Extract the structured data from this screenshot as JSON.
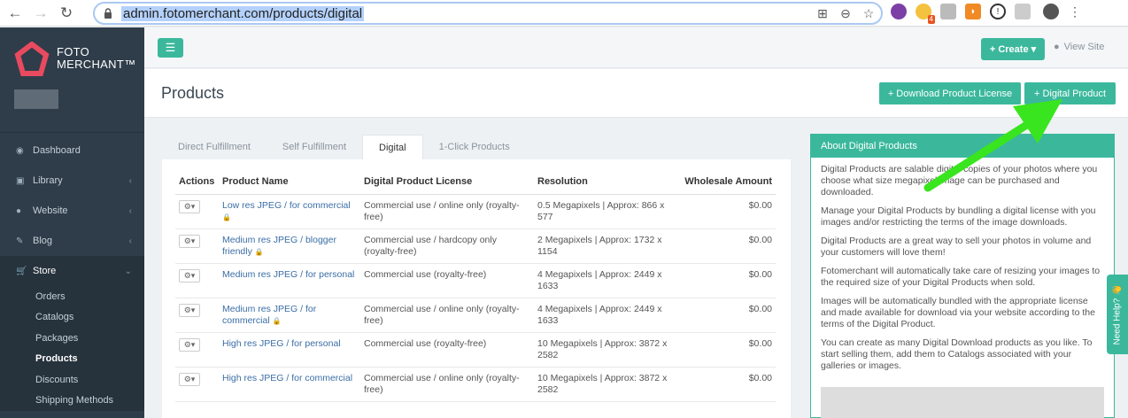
{
  "browser": {
    "url": "admin.fotomerchant.com/products/digital",
    "badge_count": "4"
  },
  "sidebar": {
    "brand_line1": "FOTO",
    "brand_line2": "MERCHANT™",
    "menu": [
      {
        "label": "Dashboard",
        "icon": "dashboard-icon"
      },
      {
        "label": "Library",
        "icon": "image-icon"
      },
      {
        "label": "Website",
        "icon": "globe-icon"
      },
      {
        "label": "Blog",
        "icon": "edit-icon"
      },
      {
        "label": "Store",
        "icon": "cart-icon"
      }
    ],
    "store_submenu": [
      "Orders",
      "Catalogs",
      "Packages",
      "Products",
      "Discounts",
      "Shipping Methods"
    ]
  },
  "topbar": {
    "create_label": "+ Create ▾",
    "view_site_label": "View Site"
  },
  "page": {
    "title": "Products",
    "download_license_btn": "+ Download Product License",
    "digital_product_btn": "+ Digital Product"
  },
  "tabs": [
    "Direct Fulfillment",
    "Self Fulfillment",
    "Digital",
    "1-Click Products"
  ],
  "table": {
    "headers": [
      "Actions",
      "Product Name",
      "Digital Product License",
      "Resolution",
      "Wholesale Amount"
    ],
    "rows": [
      {
        "name": "Low res JPEG / for commercial",
        "license": "Commercial use / online only (royalty-free)",
        "resolution": "0.5 Megapixels | Approx: 866 x 577",
        "amount": "$0.00"
      },
      {
        "name": "Medium res JPEG / blogger friendly",
        "license": "Commercial use / hardcopy only (royalty-free)",
        "resolution": "2 Megapixels | Approx: 1732 x 1154",
        "amount": "$0.00"
      },
      {
        "name": "Medium res JPEG / for personal",
        "license": "Commercial use (royalty-free)",
        "resolution": "4 Megapixels | Approx: 2449 x 1633",
        "amount": "$0.00"
      },
      {
        "name": "Medium res JPEG / for commercial",
        "license": "Commercial use / online only (royalty-free)",
        "resolution": "4 Megapixels | Approx: 2449 x 1633",
        "amount": "$0.00"
      },
      {
        "name": "High res JPEG / for personal",
        "license": "Commercial use (royalty-free)",
        "resolution": "10 Megapixels | Approx: 3872 x 2582",
        "amount": "$0.00"
      },
      {
        "name": "High res JPEG / for commercial",
        "license": "Commercial use / online only (royalty-free)",
        "resolution": "10 Megapixels | Approx: 3872 x 2582",
        "amount": "$0.00"
      }
    ]
  },
  "about": {
    "title": "About Digital Products",
    "paragraphs": [
      "Digital Products are salable digital copies of your photos where you choose what size megapixel image can be purchased and downloaded.",
      "Manage your Digital Products by bundling a digital license with you images and/or restricting the terms of the image downloads.",
      "Digital Products are a great way to sell your photos in volume and your customers will love them!",
      "Fotomerchant will automatically take care of resizing your images to the required size of your Digital Products when sold.",
      "Images will be automatically bundled with the appropriate license and made available for download via your website according to the terms of the Digital Product.",
      "You can create as many Digital Download products as you like. To start selling them, add them to Catalogs associated with your galleries or images."
    ]
  },
  "help_tab": "Need Help? 👋",
  "colors": {
    "accent": "#3bb89c",
    "sidebar": "#2f3d4a",
    "arrow": "#39e51e"
  }
}
